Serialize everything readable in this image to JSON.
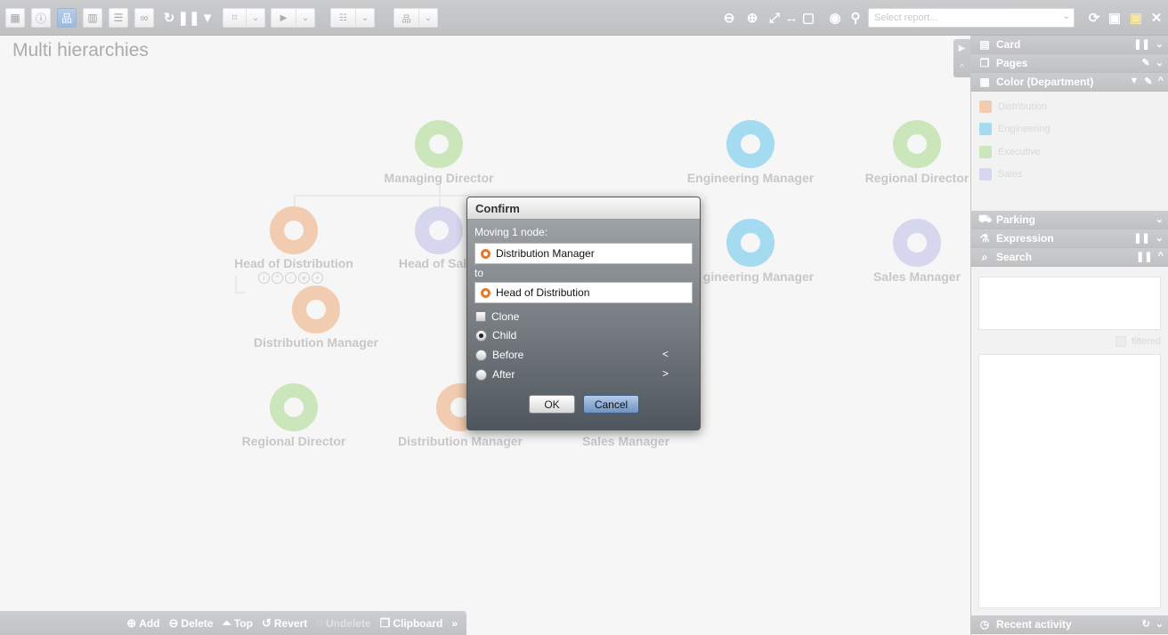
{
  "toolbar": {
    "report_placeholder": "Select report..."
  },
  "page": {
    "title": "Multi hierarchies"
  },
  "colors": {
    "distribution": "#e8a26f",
    "engineering": "#5bbde4",
    "executive": "#9ed282",
    "sales": "#b5b5e0"
  },
  "nodes": {
    "managing_director": "Managing Director",
    "engineering_manager_1": "Engineering Manager",
    "regional_director_1": "Regional Director",
    "head_of_distribution": "Head of Distribution",
    "head_of_sales": "Head of Sal",
    "engineering_manager_2": "gineering Manager",
    "sales_manager_1": "Sales Manager",
    "distribution_manager_1": "Distribution Manager",
    "regional_director_2": "Regional Director",
    "distribution_manager_2": "Distribution Manager",
    "sales_manager_2": "Sales Manager"
  },
  "bottom_bar": {
    "add": "Add",
    "delete": "Delete",
    "top": "Top",
    "revert": "Revert",
    "undelete": "Undelete",
    "clipboard": "Clipboard"
  },
  "panel": {
    "card": "Card",
    "pages": "Pages",
    "color": "Color (Department)",
    "legend": [
      "Distribution",
      "Engineering",
      "Executive",
      "Sales"
    ],
    "parking": "Parking",
    "expression": "Expression",
    "search": "Search",
    "filtered": "filtered",
    "recent_activity": "Recent activity"
  },
  "dialog": {
    "title": "Confirm",
    "moving": "Moving 1 node:",
    "source": "Distribution Manager",
    "to": "to",
    "target": "Head of Distribution",
    "clone": "Clone",
    "child": "Child",
    "before": "Before",
    "after": "After",
    "before_key": "<",
    "after_key": ">",
    "ok": "OK",
    "cancel": "Cancel"
  }
}
